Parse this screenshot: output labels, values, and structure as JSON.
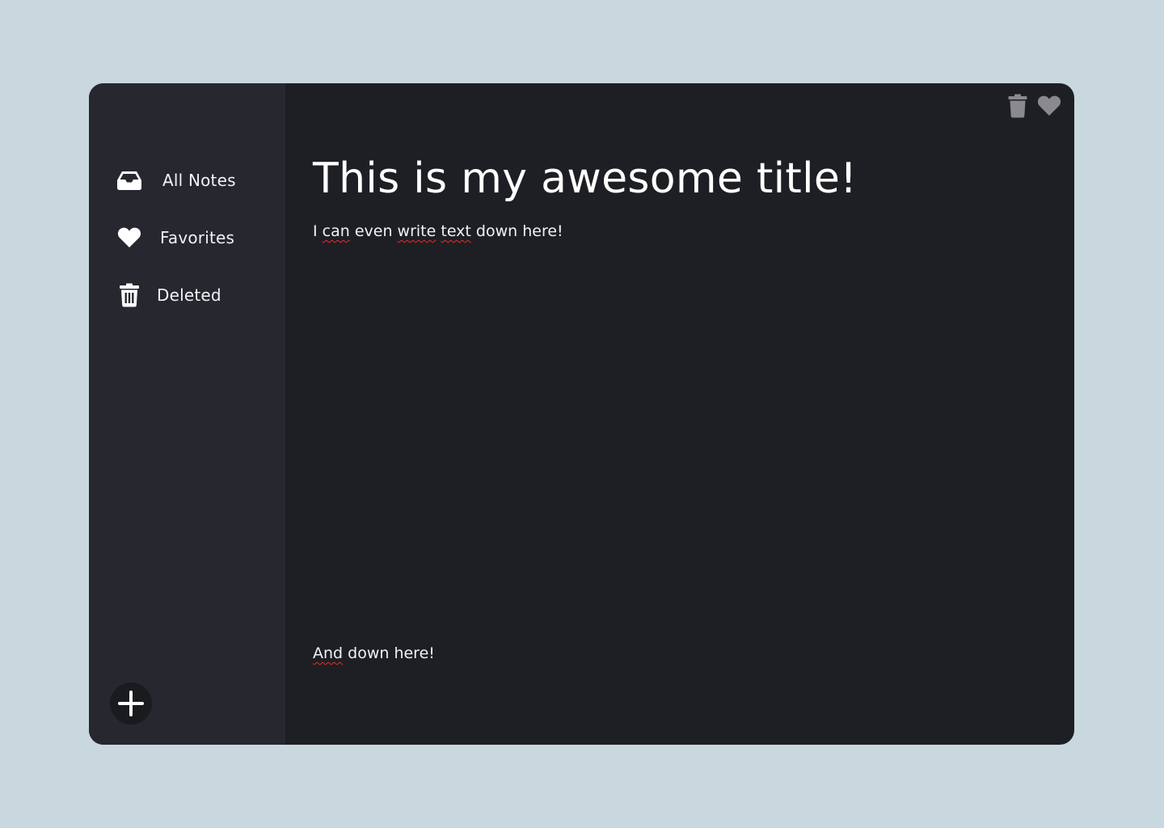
{
  "sidebar": {
    "items": [
      {
        "label": "All Notes",
        "icon": "inbox-icon"
      },
      {
        "label": "Favorites",
        "icon": "heart-icon"
      },
      {
        "label": "Deleted",
        "icon": "trash-icon"
      }
    ],
    "add_button": {
      "icon": "plus-icon"
    }
  },
  "toolbar": {
    "delete_icon": "trash-icon",
    "favorite_icon": "heart-icon"
  },
  "note": {
    "title": "This is my awesome title!",
    "lines": [
      {
        "segments": [
          {
            "text": "I "
          },
          {
            "text": "can",
            "misspelled": true
          },
          {
            "text": " even "
          },
          {
            "text": "write",
            "misspelled": true
          },
          {
            "text": " "
          },
          {
            "text": "text",
            "misspelled": true
          },
          {
            "text": " down here!"
          }
        ]
      },
      {
        "segments": [
          {
            "text": "And",
            "misspelled": true
          },
          {
            "text": " down here!"
          }
        ]
      }
    ]
  },
  "colors": {
    "background": "#c9d7de",
    "sidebar": "#26272f",
    "editor": "#1e1f24",
    "text": "#ffffff",
    "toolbar_icon": "#8a8a8e",
    "spellcheck": "#e0302e"
  }
}
